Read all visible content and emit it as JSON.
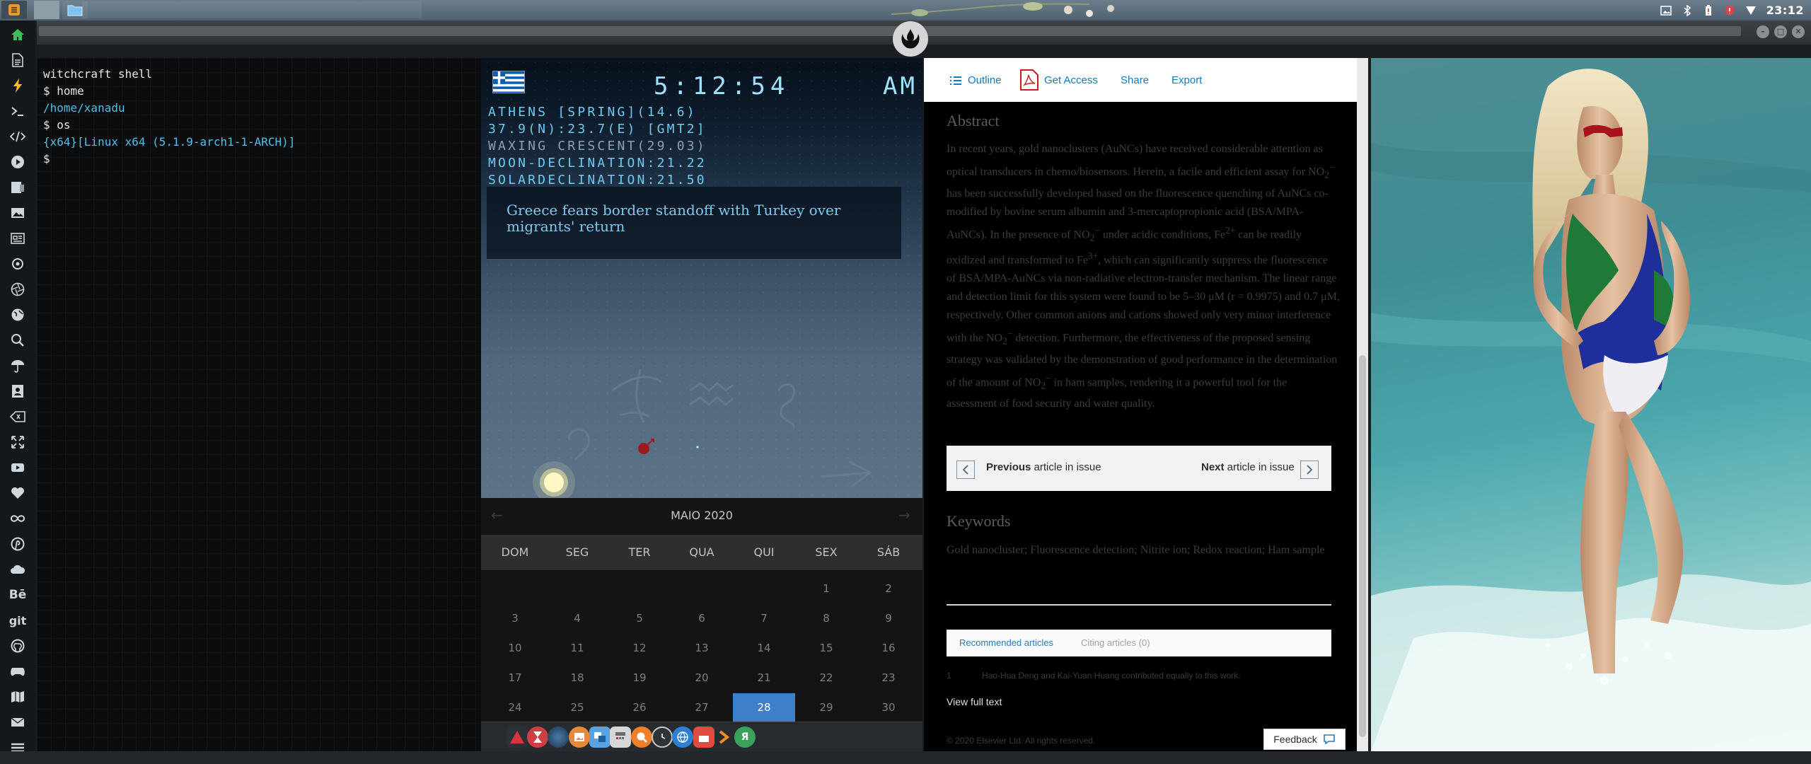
{
  "taskbar": {
    "clock": "23:12"
  },
  "terminal": {
    "title": "witchcraft shell",
    "lines": [
      {
        "text": "$ home",
        "style": "white"
      },
      {
        "text": "/home/xanadu",
        "style": "cyan"
      },
      {
        "text": "$ os",
        "style": "white"
      },
      {
        "text": "{x64}[Linux x64 (5.1.9-arch1-1-ARCH)]",
        "style": "cyan"
      },
      {
        "text": "$",
        "style": "white"
      }
    ]
  },
  "astro": {
    "time": "5:12:54",
    "ampm": "AM",
    "lines": [
      "ATHENS [SPRING](14.6)",
      "37.9(N):23.7(E) [GMT2]",
      "WAXING CRESCENT(29.03)",
      "MOON-DECLINATION:21.22",
      "SOLARDECLINATION:21.50"
    ],
    "news": "Greece fears border standoff with Turkey over migrants' return"
  },
  "calendar": {
    "month": "MAIO 2020",
    "weekdays": [
      "DOM",
      "SEG",
      "TER",
      "QUA",
      "QUI",
      "SEX",
      "SÁB"
    ],
    "weeks": [
      [
        "",
        "",
        "",
        "",
        "",
        "1",
        "2"
      ],
      [
        "3",
        "4",
        "5",
        "6",
        "7",
        "8",
        "9"
      ],
      [
        "10",
        "11",
        "12",
        "13",
        "14",
        "15",
        "16"
      ],
      [
        "17",
        "18",
        "19",
        "20",
        "21",
        "22",
        "23"
      ],
      [
        "24",
        "25",
        "26",
        "27",
        "28",
        "29",
        "30"
      ]
    ],
    "selected": "28"
  },
  "article": {
    "toolbar": {
      "outline": "Outline",
      "get_access": "Get Access",
      "share": "Share",
      "export": "Export"
    },
    "abstract_heading": "Abstract",
    "abstract_html": "In recent years, gold nanoclusters (AuNCs) have received considerable attention as optical transducers in chemo/biosensors. Herein, a facile and efficient assay for NO<sub>2</sub><sup>−</sup> has been successfully developed based on the fluorescence quenching of AuNCs co-modified by bovine serum albumin and 3-mercaptopropionic acid (BSA/MPA-AuNCs). In the presence of NO<sub>2</sub><sup>−</sup> under acidic conditions, Fe<sup>2+</sup> can be readily oxidized and transformed to Fe<sup>3+</sup>, which can significantly suppress the fluorescence of BSA/MPA-AuNCs via non-radiative electron-transfer mechanism. The linear range and detection limit for this system were found to be 5–30 μM (r = 0.9975) and 0.7 μM, respectively. Other common anions and cations showed only very minor interference with the NO<sub>2</sub><sup>−</sup> detection. Furthermore, the effectiveness of the proposed sensing strategy was validated by the demonstration of good performance in the determination of the amount of NO<sub>2</sub><sup>−</sup> in ham samples, rendering it a powerful tool for the assessment of food security and water quality.",
    "prev": {
      "bold": "Previous",
      "rest": " article in issue"
    },
    "next": {
      "bold": "Next",
      "rest": " article in issue"
    },
    "keywords_heading": "Keywords",
    "keywords": "Gold nanocluster; Fluorescence detection; Nitrite ion; Redox reaction; Ham sample",
    "tabs": {
      "recommended": "Recommended articles",
      "citing": "Citing articles (0)"
    },
    "footnote_mark": "1",
    "footnote": "Hao-Hua Deng and Kai-Yuan Huang contributed equally to this work.",
    "view_full": "View full text",
    "copyright": "© 2020 Elsevier Ltd. All rights reserved.",
    "feedback": "Feedback"
  },
  "sidebar": {
    "items": [
      "home-icon",
      "file-icon",
      "bolt-icon",
      "terminal-icon",
      "code-icon",
      "play-icon",
      "media-icon",
      "image-icon",
      "news-icon",
      "settings-icon",
      "aperture-icon",
      "globe-icon",
      "search-icon",
      "umbrella-icon",
      "contact-icon",
      "tag-icon",
      "expand-icon",
      "youtube-icon",
      "heart-icon",
      "lastfm-icon",
      "pinterest-icon",
      "cloud-icon",
      "behance-text",
      "git-text",
      "github-icon",
      "gamepad-icon",
      "map-icon",
      "mail-icon",
      "stack-icon"
    ],
    "behance_label": "Bē",
    "git_label": "git"
  },
  "colors": {
    "accent": "#3e7fc9",
    "link": "#0c7dbb",
    "astro_text": "#9fe2ff",
    "terminal_cyan": "#4fc1e9"
  }
}
